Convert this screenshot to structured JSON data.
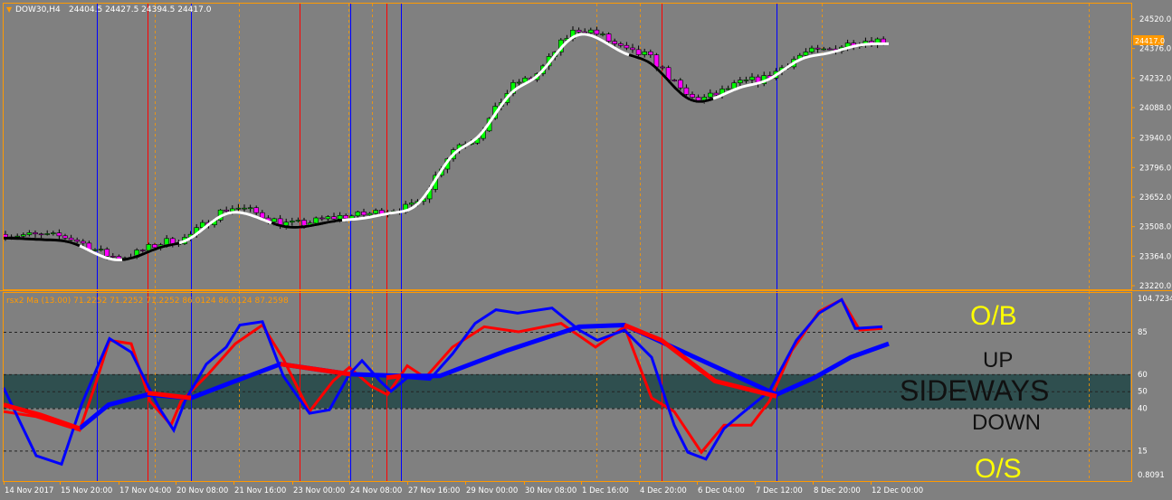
{
  "main": {
    "header_symbol": "DOW30,H4",
    "header_ohlc": "24404.5 24427.5 24394.5 24417.0",
    "price_ticks": [
      "24520.0",
      "24376.0",
      "24232.0",
      "24088.0",
      "23940.0",
      "23796.0",
      "23652.0",
      "23508.0",
      "23364.0",
      "23220.0"
    ],
    "current_price": "24417.0"
  },
  "sub": {
    "header": "rsx2 Ma (13.00) 71.2252 71.2252 71.2252 86.0124 86.0124 87.2598",
    "scale_ticks": [
      "104.7234",
      "85",
      "60",
      "50",
      "40",
      "15",
      "0.8091"
    ],
    "labels": {
      "ob": "O/B",
      "up": "UP",
      "sideways": "SIDEWAYS",
      "down": "DOWN",
      "os": "O/S"
    }
  },
  "time_labels": [
    "14 Nov 2017",
    "15 Nov 20:00",
    "17 Nov 04:00",
    "20 Nov 08:00",
    "21 Nov 16:00",
    "23 Nov 00:00",
    "24 Nov 08:00",
    "27 Nov 16:00",
    "29 Nov 00:00",
    "30 Nov 08:00",
    "1 Dec 16:00",
    "4 Dec 20:00",
    "6 Dec 04:00",
    "7 Dec 12:00",
    "8 Dec 20:00",
    "12 Dec 00:00"
  ],
  "colors": {
    "background": "#808080",
    "frame": "#ff9900",
    "bull": "#00ff00",
    "bear": "#ff00ff",
    "ma_up": "#ffffff",
    "ma_down": "#000000",
    "rsx_fast": "#0000ff",
    "rsx_slow": "#ff0000",
    "zone": "#2f4f4f",
    "label_yellow": "#ffff00",
    "price_tag": "#ff9900"
  },
  "chart_data": [
    {
      "type": "candlestick",
      "title": "DOW30,H4",
      "y_range": [
        23220.0,
        24520.0
      ],
      "close_path": [
        [
          "14 Nov 2017",
          23470
        ],
        [
          "15 Nov 20:00",
          23460
        ],
        [
          "17 Nov 04:00",
          23360
        ],
        [
          "20 Nov 08:00",
          23440
        ],
        [
          "21 Nov 16:00",
          23600
        ],
        [
          "23 Nov 00:00",
          23520
        ],
        [
          "24 Nov 08:00",
          23560
        ],
        [
          "27 Nov 16:00",
          23600
        ],
        [
          "29 Nov 00:00",
          23920
        ],
        [
          "30 Nov 08:00",
          24220
        ],
        [
          "1 Dec 16:00",
          24470
        ],
        [
          "4 Dec 20:00",
          24350
        ],
        [
          "6 Dec 04:00",
          24130
        ],
        [
          "7 Dec 12:00",
          24220
        ],
        [
          "8 Dec 20:00",
          24360
        ],
        [
          "12 Dec 00:00",
          24417
        ]
      ]
    },
    {
      "type": "line",
      "title": "rsx2 Ma (13.00)",
      "y_range": [
        0.8091,
        104.7234
      ],
      "levels": [
        85,
        60,
        50,
        40,
        15
      ],
      "zone": [
        40,
        60
      ]
    }
  ]
}
